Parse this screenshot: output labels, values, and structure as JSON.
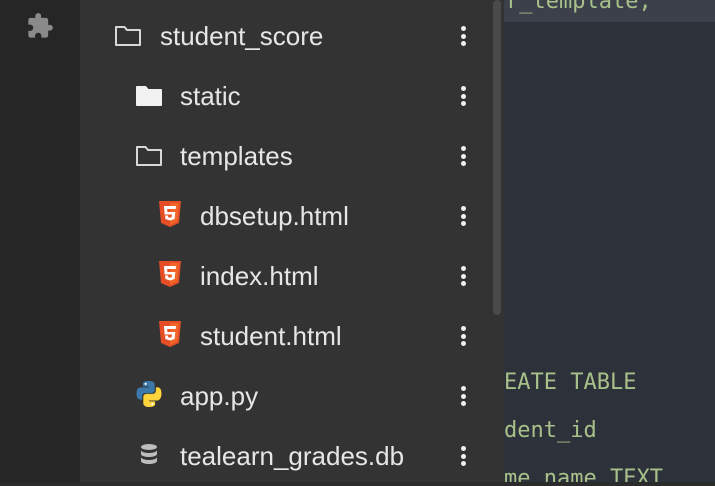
{
  "activity_bar": {
    "extensions_icon": "puzzle-piece-icon"
  },
  "file_tree": {
    "items": [
      {
        "label": "student_score",
        "icon": "folder-outline-icon"
      },
      {
        "label": "static",
        "icon": "folder-solid-icon"
      },
      {
        "label": "templates",
        "icon": "folder-outline-icon"
      },
      {
        "label": "dbsetup.html",
        "icon": "html5-icon"
      },
      {
        "label": "index.html",
        "icon": "html5-icon"
      },
      {
        "label": "student.html",
        "icon": "html5-icon"
      },
      {
        "label": "app.py",
        "icon": "python-icon"
      },
      {
        "label": "tealearn_grades.db",
        "icon": "database-icon"
      }
    ],
    "more_icon": "more-vertical-icon"
  },
  "editor": {
    "lines": [
      "r_template,",
      "EATE TABLE",
      "dent_id",
      "me_name TEXT"
    ]
  },
  "colors": {
    "tree_bg": "#333333",
    "editor_bg": "#2d3139",
    "html5": "#e44d26",
    "python_blue": "#3b77a8",
    "python_yellow": "#ffd43b",
    "code_green": "#a8c18a"
  }
}
